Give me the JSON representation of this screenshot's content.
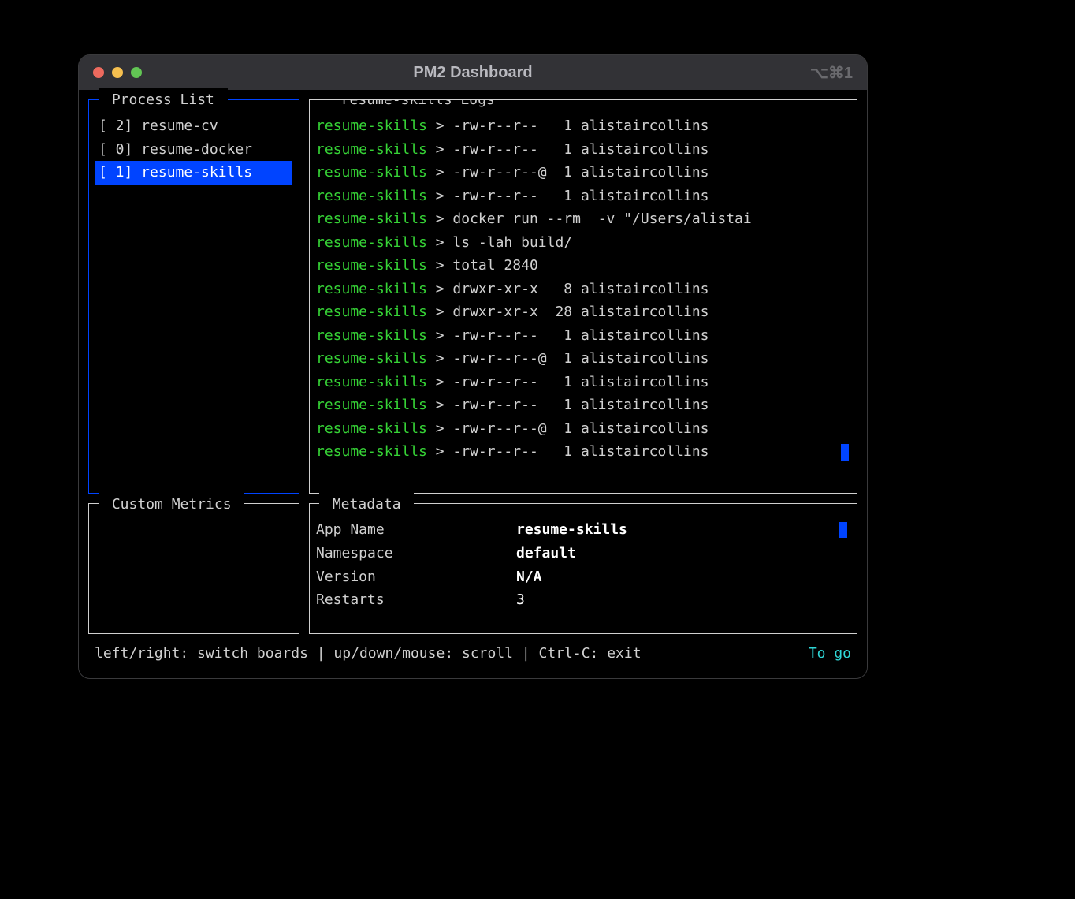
{
  "window": {
    "title": "PM2 Dashboard",
    "shortcut": "⌥⌘1"
  },
  "process_list": {
    "label": "Process List",
    "items": [
      {
        "id": "2",
        "name": "resume-cv",
        "display": "[ 2] resume-cv",
        "selected": false
      },
      {
        "id": "0",
        "name": "resume-docker",
        "display": "[ 0] resume-docker",
        "selected": false
      },
      {
        "id": "1",
        "name": "resume-skills",
        "display": "[ 1] resume-skills",
        "selected": true
      }
    ]
  },
  "logs": {
    "label": " resume-skills Logs ",
    "proc_name": "resume-skills",
    "lines": [
      "-rw-r--r--   1 alistaircollins",
      "-rw-r--r--   1 alistaircollins",
      "-rw-r--r--@  1 alistaircollins",
      "-rw-r--r--   1 alistaircollins",
      "docker run --rm  -v \"/Users/alistai",
      "ls -lah build/",
      "total 2840",
      "drwxr-xr-x   8 alistaircollins",
      "drwxr-xr-x  28 alistaircollins",
      "-rw-r--r--   1 alistaircollins",
      "-rw-r--r--@  1 alistaircollins",
      "-rw-r--r--   1 alistaircollins",
      "-rw-r--r--   1 alistaircollins",
      "-rw-r--r--@  1 alistaircollins",
      "-rw-r--r--   1 alistaircollins"
    ]
  },
  "custom_metrics": {
    "label": "Custom Metrics"
  },
  "metadata": {
    "label": "Metadata",
    "rows": [
      {
        "key": "App Name",
        "value": "resume-skills",
        "bold": true
      },
      {
        "key": "Namespace",
        "value": "default",
        "bold": true
      },
      {
        "key": "Version",
        "value": "N/A",
        "bold": true
      },
      {
        "key": "Restarts",
        "value": "3",
        "bold": false
      }
    ]
  },
  "footer": {
    "help": "left/right: switch boards | up/down/mouse: scroll | Ctrl-C: exit",
    "status": "To go"
  }
}
